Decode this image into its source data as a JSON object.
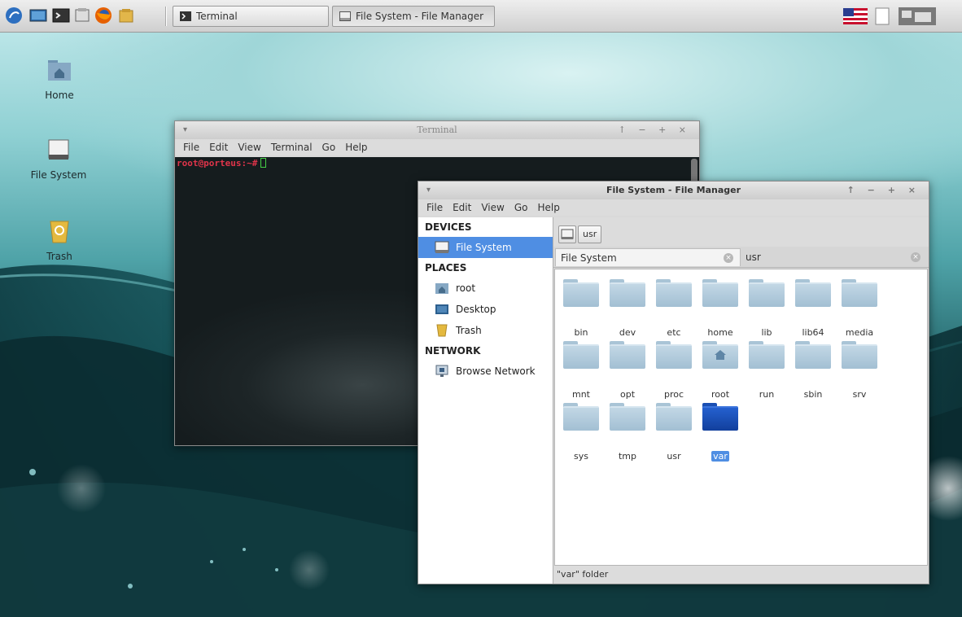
{
  "taskbar": {
    "tasks": [
      {
        "label": "Terminal"
      },
      {
        "label": "File System - File Manager"
      }
    ],
    "colors": {
      "accent": "#4f8ee3"
    }
  },
  "desktop_icons": [
    {
      "label": "Home"
    },
    {
      "label": "File System"
    },
    {
      "label": "Trash"
    }
  ],
  "terminal": {
    "title": "Terminal",
    "menu": [
      "File",
      "Edit",
      "View",
      "Terminal",
      "Go",
      "Help"
    ],
    "prompt": "root@porteus:~#"
  },
  "file_manager": {
    "title": "File System - File Manager",
    "menu": [
      "File",
      "Edit",
      "View",
      "Go",
      "Help"
    ],
    "sidebar": {
      "devices_header": "DEVICES",
      "devices": [
        {
          "label": "File System"
        }
      ],
      "places_header": "PLACES",
      "places": [
        {
          "label": "root"
        },
        {
          "label": "Desktop"
        },
        {
          "label": "Trash"
        }
      ],
      "network_header": "NETWORK",
      "network": [
        {
          "label": "Browse Network"
        }
      ]
    },
    "pathbar": {
      "usr_label": "usr"
    },
    "tabs": [
      {
        "label": "File System"
      },
      {
        "label": "usr"
      }
    ],
    "folders": [
      "bin",
      "dev",
      "etc",
      "home",
      "lib",
      "lib64",
      "media",
      "mnt",
      "opt",
      "proc",
      "root",
      "run",
      "sbin",
      "srv",
      "sys",
      "tmp",
      "usr",
      "var"
    ],
    "selected_folder": "var",
    "status": "\"var\" folder"
  }
}
